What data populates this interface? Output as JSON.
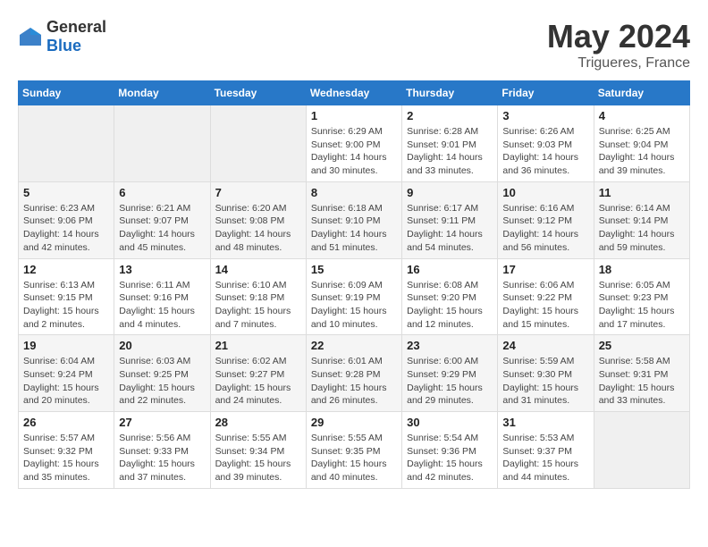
{
  "logo": {
    "general": "General",
    "blue": "Blue"
  },
  "title": "May 2024",
  "subtitle": "Trigueres, France",
  "days_header": [
    "Sunday",
    "Monday",
    "Tuesday",
    "Wednesday",
    "Thursday",
    "Friday",
    "Saturday"
  ],
  "weeks": [
    [
      {
        "num": "",
        "info": ""
      },
      {
        "num": "",
        "info": ""
      },
      {
        "num": "",
        "info": ""
      },
      {
        "num": "1",
        "info": "Sunrise: 6:29 AM\nSunset: 9:00 PM\nDaylight: 14 hours\nand 30 minutes."
      },
      {
        "num": "2",
        "info": "Sunrise: 6:28 AM\nSunset: 9:01 PM\nDaylight: 14 hours\nand 33 minutes."
      },
      {
        "num": "3",
        "info": "Sunrise: 6:26 AM\nSunset: 9:03 PM\nDaylight: 14 hours\nand 36 minutes."
      },
      {
        "num": "4",
        "info": "Sunrise: 6:25 AM\nSunset: 9:04 PM\nDaylight: 14 hours\nand 39 minutes."
      }
    ],
    [
      {
        "num": "5",
        "info": "Sunrise: 6:23 AM\nSunset: 9:06 PM\nDaylight: 14 hours\nand 42 minutes."
      },
      {
        "num": "6",
        "info": "Sunrise: 6:21 AM\nSunset: 9:07 PM\nDaylight: 14 hours\nand 45 minutes."
      },
      {
        "num": "7",
        "info": "Sunrise: 6:20 AM\nSunset: 9:08 PM\nDaylight: 14 hours\nand 48 minutes."
      },
      {
        "num": "8",
        "info": "Sunrise: 6:18 AM\nSunset: 9:10 PM\nDaylight: 14 hours\nand 51 minutes."
      },
      {
        "num": "9",
        "info": "Sunrise: 6:17 AM\nSunset: 9:11 PM\nDaylight: 14 hours\nand 54 minutes."
      },
      {
        "num": "10",
        "info": "Sunrise: 6:16 AM\nSunset: 9:12 PM\nDaylight: 14 hours\nand 56 minutes."
      },
      {
        "num": "11",
        "info": "Sunrise: 6:14 AM\nSunset: 9:14 PM\nDaylight: 14 hours\nand 59 minutes."
      }
    ],
    [
      {
        "num": "12",
        "info": "Sunrise: 6:13 AM\nSunset: 9:15 PM\nDaylight: 15 hours\nand 2 minutes."
      },
      {
        "num": "13",
        "info": "Sunrise: 6:11 AM\nSunset: 9:16 PM\nDaylight: 15 hours\nand 4 minutes."
      },
      {
        "num": "14",
        "info": "Sunrise: 6:10 AM\nSunset: 9:18 PM\nDaylight: 15 hours\nand 7 minutes."
      },
      {
        "num": "15",
        "info": "Sunrise: 6:09 AM\nSunset: 9:19 PM\nDaylight: 15 hours\nand 10 minutes."
      },
      {
        "num": "16",
        "info": "Sunrise: 6:08 AM\nSunset: 9:20 PM\nDaylight: 15 hours\nand 12 minutes."
      },
      {
        "num": "17",
        "info": "Sunrise: 6:06 AM\nSunset: 9:22 PM\nDaylight: 15 hours\nand 15 minutes."
      },
      {
        "num": "18",
        "info": "Sunrise: 6:05 AM\nSunset: 9:23 PM\nDaylight: 15 hours\nand 17 minutes."
      }
    ],
    [
      {
        "num": "19",
        "info": "Sunrise: 6:04 AM\nSunset: 9:24 PM\nDaylight: 15 hours\nand 20 minutes."
      },
      {
        "num": "20",
        "info": "Sunrise: 6:03 AM\nSunset: 9:25 PM\nDaylight: 15 hours\nand 22 minutes."
      },
      {
        "num": "21",
        "info": "Sunrise: 6:02 AM\nSunset: 9:27 PM\nDaylight: 15 hours\nand 24 minutes."
      },
      {
        "num": "22",
        "info": "Sunrise: 6:01 AM\nSunset: 9:28 PM\nDaylight: 15 hours\nand 26 minutes."
      },
      {
        "num": "23",
        "info": "Sunrise: 6:00 AM\nSunset: 9:29 PM\nDaylight: 15 hours\nand 29 minutes."
      },
      {
        "num": "24",
        "info": "Sunrise: 5:59 AM\nSunset: 9:30 PM\nDaylight: 15 hours\nand 31 minutes."
      },
      {
        "num": "25",
        "info": "Sunrise: 5:58 AM\nSunset: 9:31 PM\nDaylight: 15 hours\nand 33 minutes."
      }
    ],
    [
      {
        "num": "26",
        "info": "Sunrise: 5:57 AM\nSunset: 9:32 PM\nDaylight: 15 hours\nand 35 minutes."
      },
      {
        "num": "27",
        "info": "Sunrise: 5:56 AM\nSunset: 9:33 PM\nDaylight: 15 hours\nand 37 minutes."
      },
      {
        "num": "28",
        "info": "Sunrise: 5:55 AM\nSunset: 9:34 PM\nDaylight: 15 hours\nand 39 minutes."
      },
      {
        "num": "29",
        "info": "Sunrise: 5:55 AM\nSunset: 9:35 PM\nDaylight: 15 hours\nand 40 minutes."
      },
      {
        "num": "30",
        "info": "Sunrise: 5:54 AM\nSunset: 9:36 PM\nDaylight: 15 hours\nand 42 minutes."
      },
      {
        "num": "31",
        "info": "Sunrise: 5:53 AM\nSunset: 9:37 PM\nDaylight: 15 hours\nand 44 minutes."
      },
      {
        "num": "",
        "info": ""
      }
    ]
  ]
}
